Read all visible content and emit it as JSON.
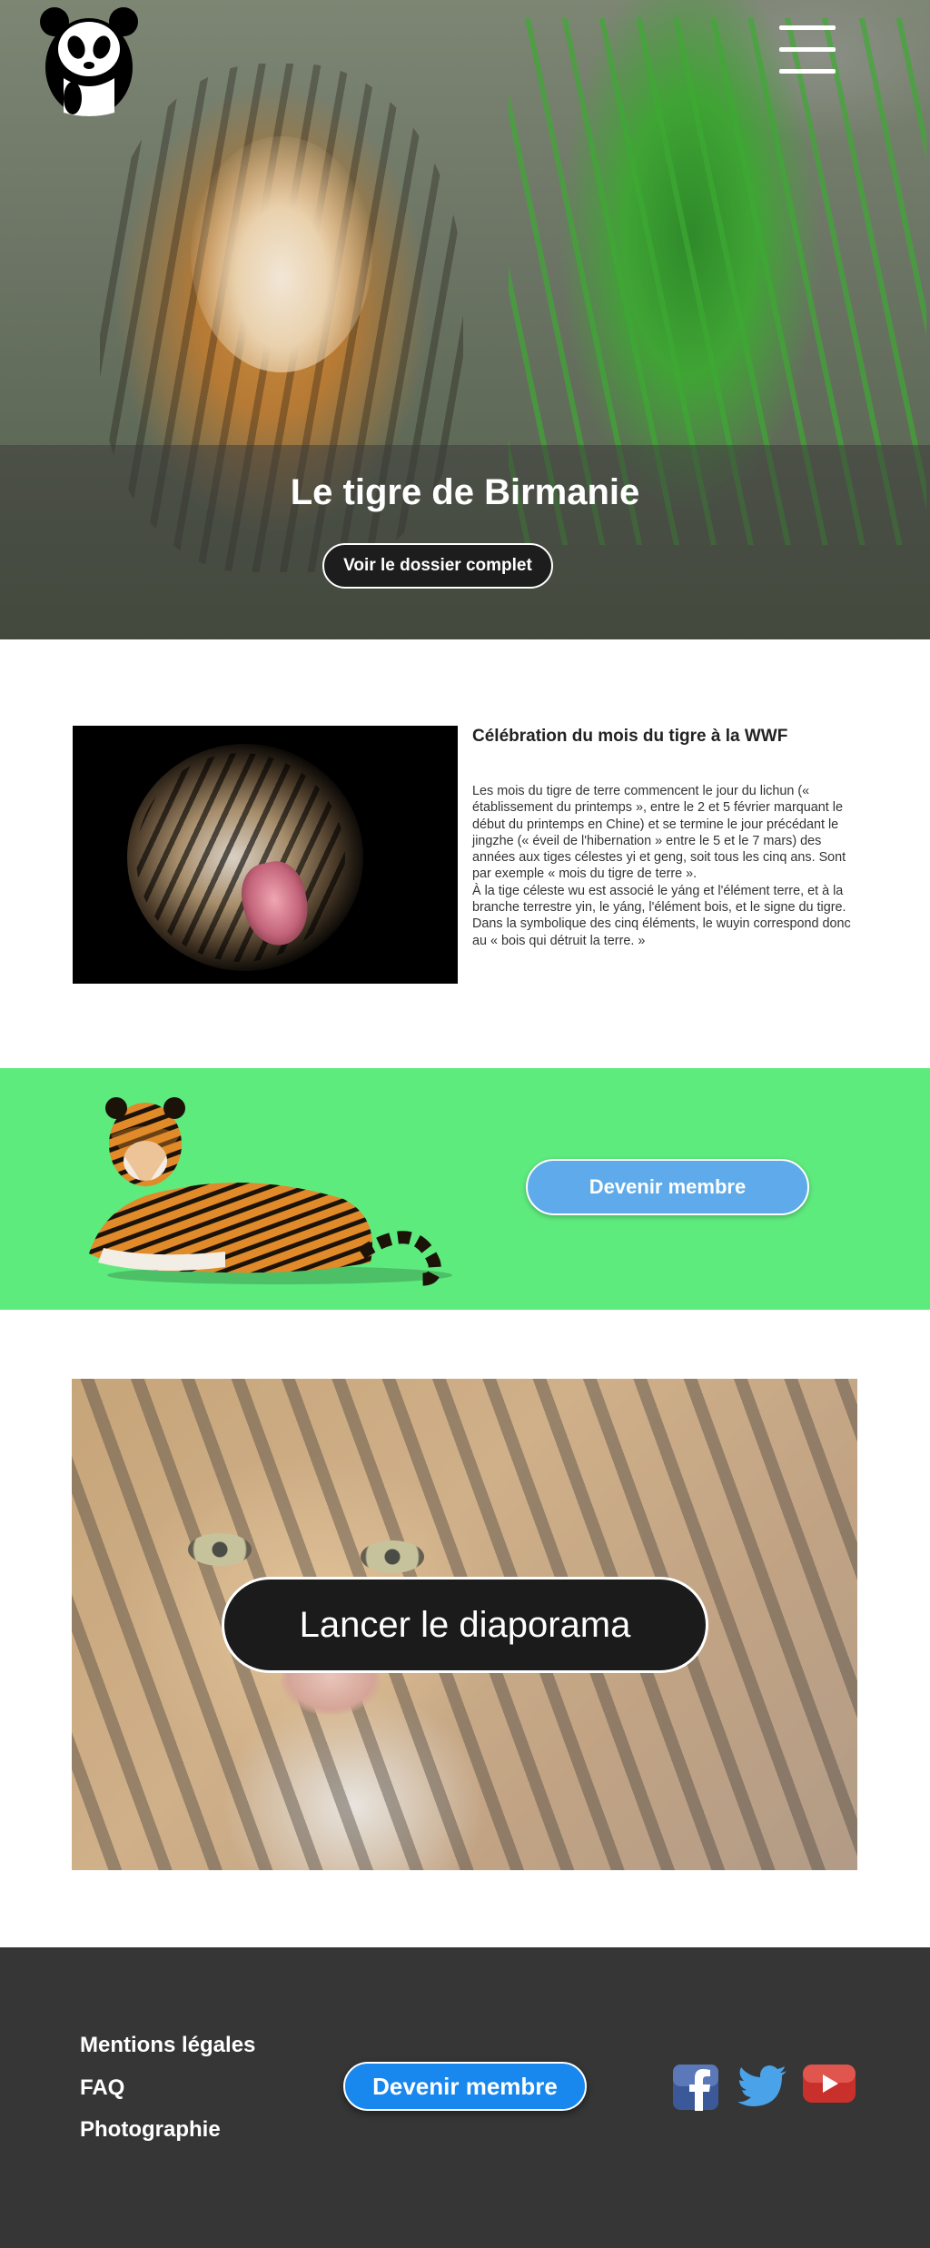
{
  "header": {
    "logo_icon": "panda-logo-icon",
    "menu_icon": "hamburger-menu-icon"
  },
  "hero": {
    "title": "Le tigre de Birmanie",
    "button_label": "Voir le dossier complet"
  },
  "article": {
    "image": "roaring-tiger-photo",
    "title": "Célébration du mois du tigre à la WWF",
    "body": "Les mois du tigre de terre commencent le jour du lichun (« établissement du printemps », entre le 2 et 5 février marquant le début du printemps en Chine) et se termine le jour précédant le jingzhe (« éveil de l'hibernation » entre le 5 et le 7 mars) des années aux tiges célestes yi et geng, soit tous les cinq ans. Sont par exemple « mois du tigre de terre ».\nÀ la tige céleste wu est associé le yáng et l'élément terre, et à la branche terrestre yin, le yáng, l'élément bois, et le signe du tigre. Dans la symbolique des cinq éléments, le wuyin correspond donc au « bois qui détruit la terre. »"
  },
  "membership": {
    "image": "lying-tiger-photo",
    "button_label": "Devenir membre",
    "background_color": "#5eeb7e",
    "button_color": "#5eaaea"
  },
  "slideshow": {
    "image": "tiger-face-closeup-photo",
    "button_label": "Lancer le diaporama"
  },
  "footer": {
    "links": [
      "Mentions légales",
      "FAQ",
      "Photographie"
    ],
    "button_label": "Devenir membre",
    "button_color": "#1887ee",
    "social_icons": [
      "facebook-icon",
      "twitter-icon",
      "youtube-icon"
    ],
    "background_color": "#363636"
  }
}
